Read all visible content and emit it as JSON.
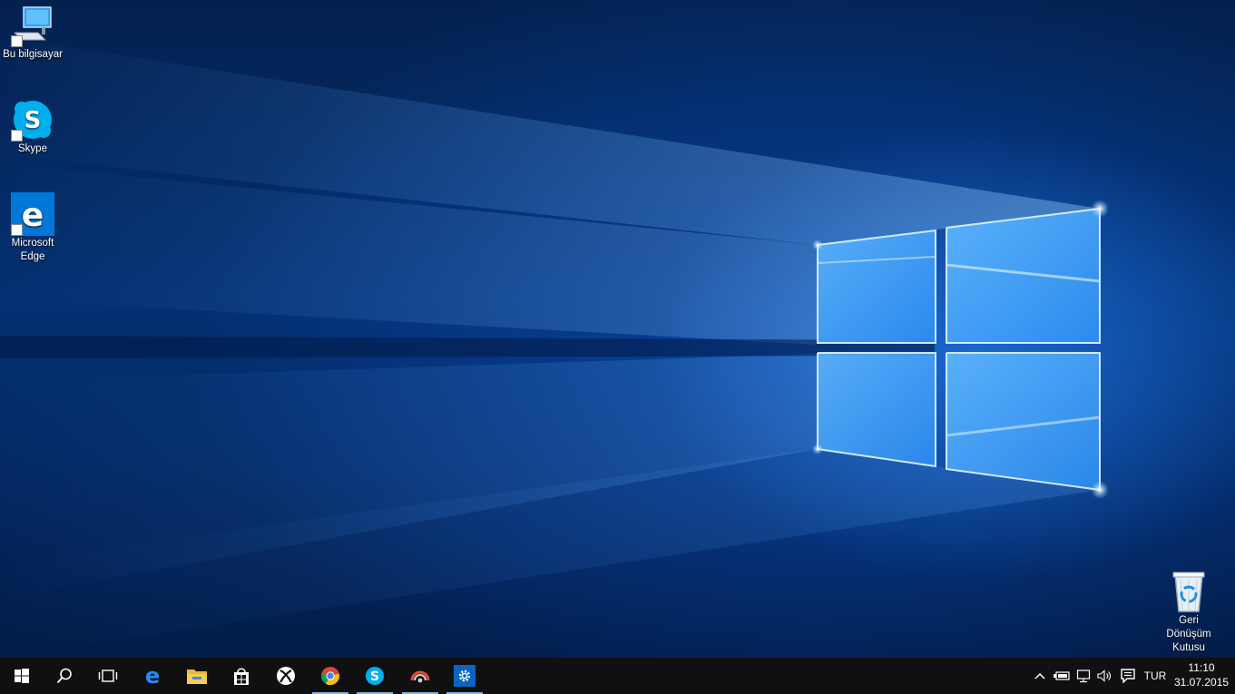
{
  "desktop": {
    "wallpaper": "windows-10-hero-light",
    "icons": [
      {
        "id": "this-pc",
        "label": "Bu bilgisayar",
        "icon": "computer-icon"
      },
      {
        "id": "skype",
        "label": "Skype",
        "icon": "skype-icon"
      },
      {
        "id": "edge",
        "label": "Microsoft Edge",
        "icon": "edge-icon"
      },
      {
        "id": "recycle-bin",
        "label": "Geri Dönüşüm Kutusu",
        "icon": "recycle-bin-icon"
      }
    ]
  },
  "taskbar": {
    "buttons": [
      {
        "id": "start",
        "icon": "windows-logo-icon"
      },
      {
        "id": "search",
        "icon": "search-icon"
      },
      {
        "id": "task-view",
        "icon": "task-view-icon"
      },
      {
        "id": "edge",
        "icon": "edge-icon"
      },
      {
        "id": "file-explorer",
        "icon": "folder-icon"
      },
      {
        "id": "store",
        "icon": "store-icon"
      },
      {
        "id": "xbox",
        "icon": "xbox-icon"
      },
      {
        "id": "chrome",
        "icon": "chrome-icon",
        "active": true
      },
      {
        "id": "skype",
        "icon": "skype-icon",
        "active": true
      },
      {
        "id": "app-ring",
        "icon": "ring-app-icon",
        "active": true
      },
      {
        "id": "settings",
        "icon": "gear-icon",
        "active": true
      }
    ],
    "tray": {
      "icons": [
        "chevron-up-icon",
        "battery-icon",
        "network-icon",
        "volume-icon",
        "action-center-icon"
      ],
      "language": "TUR",
      "time": "11:10",
      "date": "31.07.2015"
    }
  },
  "colors": {
    "accent": "#0078d7",
    "taskbar": "#101010",
    "active_indicator": "#7fb3e6"
  }
}
